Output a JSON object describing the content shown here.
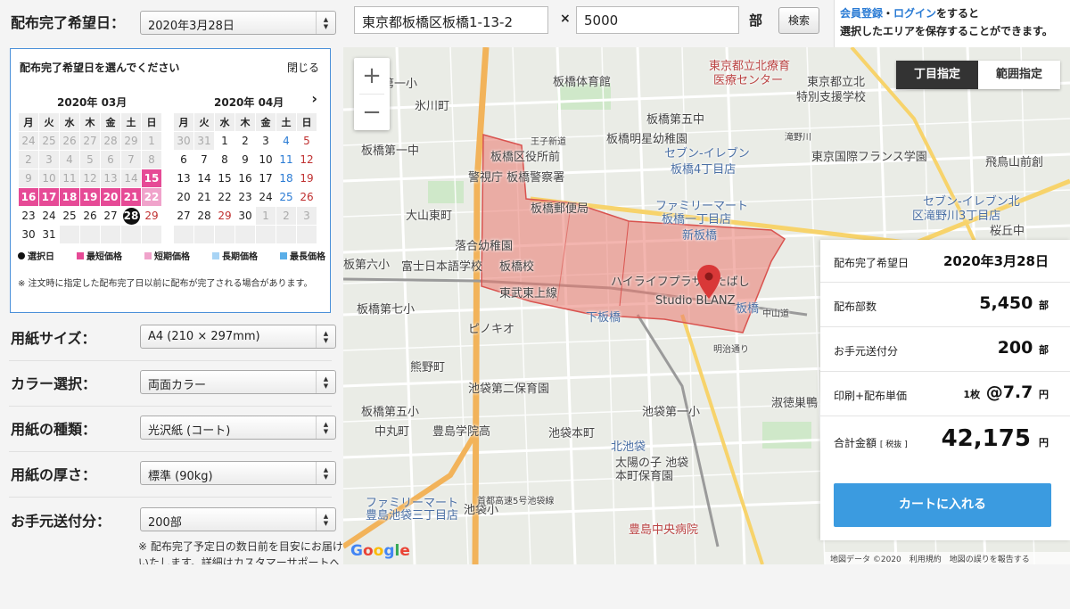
{
  "form": {
    "date_label": "配布完了希望日：",
    "date_value": "2020年3月28日",
    "paper_size_label": "用紙サイズ：",
    "paper_size_value": "A4 (210 × 297mm)",
    "color_label": "カラー選択：",
    "color_value": "両面カラー",
    "paper_type_label": "用紙の種類：",
    "paper_type_value": "光沢紙 (コート)",
    "thickness_label": "用紙の厚さ：",
    "thickness_value": "標準 (90kg)",
    "shipping_label": "お手元送付分：",
    "shipping_value": "200部",
    "bottom_note": "※ 配布完了予定日の数日前を目安にお届けいたします。詳細はカスタマーサポートへお問い合わせください。"
  },
  "calendar": {
    "heading": "配布完了希望日を選んでください",
    "close_label": "閉じる",
    "next_icon": "chevron-right-icon",
    "weekdays": [
      "月",
      "火",
      "水",
      "木",
      "金",
      "土",
      "日"
    ],
    "months": [
      {
        "title": "2020年 03月",
        "weeks": [
          [
            {
              "d": "24",
              "s": "off"
            },
            {
              "d": "25",
              "s": "off"
            },
            {
              "d": "26",
              "s": "off"
            },
            {
              "d": "27",
              "s": "off"
            },
            {
              "d": "28",
              "s": "off"
            },
            {
              "d": "29",
              "s": "off"
            },
            {
              "d": "1",
              "s": "off"
            }
          ],
          [
            {
              "d": "2",
              "s": "off"
            },
            {
              "d": "3",
              "s": "off"
            },
            {
              "d": "4",
              "s": "off"
            },
            {
              "d": "5",
              "s": "off"
            },
            {
              "d": "6",
              "s": "off"
            },
            {
              "d": "7",
              "s": "off"
            },
            {
              "d": "8",
              "s": "off"
            }
          ],
          [
            {
              "d": "9",
              "s": "off"
            },
            {
              "d": "10",
              "s": "off"
            },
            {
              "d": "11",
              "s": "off"
            },
            {
              "d": "12",
              "s": "off"
            },
            {
              "d": "13",
              "s": "off"
            },
            {
              "d": "14",
              "s": "off"
            },
            {
              "d": "15",
              "s": "pink"
            }
          ],
          [
            {
              "d": "16",
              "s": "pink"
            },
            {
              "d": "17",
              "s": "pink"
            },
            {
              "d": "18",
              "s": "pink"
            },
            {
              "d": "19",
              "s": "pink"
            },
            {
              "d": "20",
              "s": "pink"
            },
            {
              "d": "21",
              "s": "pink"
            },
            {
              "d": "22",
              "s": "lpink"
            }
          ],
          [
            {
              "d": "23",
              "s": ""
            },
            {
              "d": "24",
              "s": ""
            },
            {
              "d": "25",
              "s": ""
            },
            {
              "d": "26",
              "s": ""
            },
            {
              "d": "27",
              "s": ""
            },
            {
              "d": "28",
              "s": "sel"
            },
            {
              "d": "29",
              "s": "sun"
            }
          ],
          [
            {
              "d": "30",
              "s": ""
            },
            {
              "d": "31",
              "s": ""
            },
            {
              "d": "",
              "s": "off"
            },
            {
              "d": "",
              "s": "off"
            },
            {
              "d": "",
              "s": "off"
            },
            {
              "d": "",
              "s": "off"
            },
            {
              "d": "",
              "s": "off"
            }
          ]
        ]
      },
      {
        "title": "2020年 04月",
        "weeks": [
          [
            {
              "d": "30",
              "s": "off"
            },
            {
              "d": "31",
              "s": "off"
            },
            {
              "d": "1",
              "s": ""
            },
            {
              "d": "2",
              "s": ""
            },
            {
              "d": "3",
              "s": ""
            },
            {
              "d": "4",
              "s": "sat"
            },
            {
              "d": "5",
              "s": "sun"
            }
          ],
          [
            {
              "d": "6",
              "s": ""
            },
            {
              "d": "7",
              "s": ""
            },
            {
              "d": "8",
              "s": ""
            },
            {
              "d": "9",
              "s": ""
            },
            {
              "d": "10",
              "s": ""
            },
            {
              "d": "11",
              "s": "sat"
            },
            {
              "d": "12",
              "s": "sun"
            }
          ],
          [
            {
              "d": "13",
              "s": ""
            },
            {
              "d": "14",
              "s": ""
            },
            {
              "d": "15",
              "s": ""
            },
            {
              "d": "16",
              "s": ""
            },
            {
              "d": "17",
              "s": ""
            },
            {
              "d": "18",
              "s": "sat"
            },
            {
              "d": "19",
              "s": "sun"
            }
          ],
          [
            {
              "d": "20",
              "s": ""
            },
            {
              "d": "21",
              "s": ""
            },
            {
              "d": "22",
              "s": ""
            },
            {
              "d": "23",
              "s": ""
            },
            {
              "d": "24",
              "s": ""
            },
            {
              "d": "25",
              "s": "sat"
            },
            {
              "d": "26",
              "s": "sun"
            }
          ],
          [
            {
              "d": "27",
              "s": ""
            },
            {
              "d": "28",
              "s": ""
            },
            {
              "d": "29",
              "s": "sun"
            },
            {
              "d": "30",
              "s": ""
            },
            {
              "d": "1",
              "s": "off"
            },
            {
              "d": "2",
              "s": "off"
            },
            {
              "d": "3",
              "s": "off"
            }
          ],
          [
            {
              "d": "",
              "s": "off"
            },
            {
              "d": "",
              "s": "off"
            },
            {
              "d": "",
              "s": "off"
            },
            {
              "d": "",
              "s": "off"
            },
            {
              "d": "",
              "s": "off"
            },
            {
              "d": "",
              "s": "off"
            },
            {
              "d": "",
              "s": "off"
            }
          ]
        ]
      }
    ],
    "legend": {
      "selected": "選択日",
      "shortest": "最短価格",
      "short": "短期価格",
      "long": "長期価格",
      "longest": "最長価格"
    },
    "colors": {
      "shortest": "#e64a96",
      "short": "#f0a3cb",
      "long": "#a8d4f5",
      "longest": "#5aaee8"
    },
    "note": "※ 注文時に指定した配布完了日以前に配布が完了される場合があります。"
  },
  "search": {
    "address_value": "東京都板橋区板橋1-13-2",
    "times": "×",
    "quantity_value": "5000",
    "unit": "部",
    "button_label": "検索"
  },
  "member": {
    "register_link": "会員登録",
    "dot": "・",
    "login_link": "ログイン",
    "line1_suffix": "をすると",
    "line2": "選択したエリアを保存することができます。"
  },
  "map": {
    "zoom_in": "+",
    "zoom_out": "−",
    "mode_chome": "丁目指定",
    "mode_range": "範囲指定",
    "google": "Google",
    "attribution": "地図データ ©2020　利用規約　地図の誤りを報告する",
    "labels": [
      {
        "t": "板橋第一小",
        "c": ""
      },
      {
        "t": "氷川町",
        "c": ""
      },
      {
        "t": "板橋体育館",
        "c": ""
      },
      {
        "t": "東京都立北療育",
        "c": "red"
      },
      {
        "t": "医療センター",
        "c": "red"
      },
      {
        "t": "板橋第五中",
        "c": ""
      },
      {
        "t": "東京都立北",
        "c": ""
      },
      {
        "t": "特別支援学校",
        "c": ""
      },
      {
        "t": "板橋明星幼稚園",
        "c": ""
      },
      {
        "t": "板橋第一中",
        "c": ""
      },
      {
        "t": "板橋区役所前",
        "c": ""
      },
      {
        "t": "警視庁 板橋警察署",
        "c": ""
      },
      {
        "t": "セブン-イレブン",
        "c": "blue"
      },
      {
        "t": "板橋4丁目店",
        "c": "blue"
      },
      {
        "t": "東京国際フランス学園",
        "c": ""
      },
      {
        "t": "飛鳥山前創",
        "c": ""
      },
      {
        "t": "板橋郵便局",
        "c": ""
      },
      {
        "t": "ファミリーマート",
        "c": "blue"
      },
      {
        "t": "板橋一丁目店",
        "c": "blue"
      },
      {
        "t": "セブン-イレブン北",
        "c": "blue"
      },
      {
        "t": "区滝野川3丁目店",
        "c": "blue"
      },
      {
        "t": "大山東町",
        "c": ""
      },
      {
        "t": "新板橋",
        "c": "blue"
      },
      {
        "t": "桜丘中",
        "c": ""
      },
      {
        "t": "落合幼稚園",
        "c": ""
      },
      {
        "t": "板第六小",
        "c": ""
      },
      {
        "t": "富士日本語学校",
        "c": ""
      },
      {
        "t": "板橋校",
        "c": ""
      },
      {
        "t": "ハイライフプラザいたばし",
        "c": ""
      },
      {
        "t": "東武東上線",
        "c": ""
      },
      {
        "t": "Studio BLANZ",
        "c": ""
      },
      {
        "t": "板橋第七小",
        "c": ""
      },
      {
        "t": "下板橋",
        "c": "blue"
      },
      {
        "t": "ピノキオ",
        "c": ""
      },
      {
        "t": "板橋",
        "c": "blue"
      },
      {
        "t": "熊野町",
        "c": ""
      },
      {
        "t": "池袋第二保育園",
        "c": ""
      },
      {
        "t": "板橋第五小",
        "c": ""
      },
      {
        "t": "池袋第一小",
        "c": ""
      },
      {
        "t": "淑徳巣鴨",
        "c": ""
      },
      {
        "t": "豊島学院高",
        "c": ""
      },
      {
        "t": "池袋本町",
        "c": ""
      },
      {
        "t": "北池袋",
        "c": "blue"
      },
      {
        "t": "中丸町",
        "c": ""
      },
      {
        "t": "太陽の子 池袋",
        "c": ""
      },
      {
        "t": "本町保育園",
        "c": ""
      },
      {
        "t": "ファミリーマート",
        "c": "blue"
      },
      {
        "t": "豊島池袋三丁目店",
        "c": "blue"
      },
      {
        "t": "池袋小",
        "c": ""
      },
      {
        "t": "豊島中央病院",
        "c": "red"
      },
      {
        "t": "王子新道",
        "c": ""
      },
      {
        "t": "滝野川",
        "c": ""
      },
      {
        "t": "中山道",
        "c": ""
      },
      {
        "t": "首都高速5号池袋線",
        "c": ""
      },
      {
        "t": "明治通り",
        "c": ""
      }
    ]
  },
  "summary": {
    "date_label": "配布完了希望日",
    "date_value": "2020年3月28日",
    "count_label": "配布部数",
    "count_value": "5,450",
    "count_unit": "部",
    "ship_label": "お手元送付分",
    "ship_value": "200",
    "ship_unit": "部",
    "unit_label": "印刷+配布単価",
    "unit_prefix": "1枚",
    "unit_value": "@7.7",
    "unit_suffix": "円",
    "total_label": "合計金額",
    "total_tax": "[ 税抜 ]",
    "total_value": "42,175",
    "total_unit": "円",
    "cart_button": "カートに入れる"
  }
}
